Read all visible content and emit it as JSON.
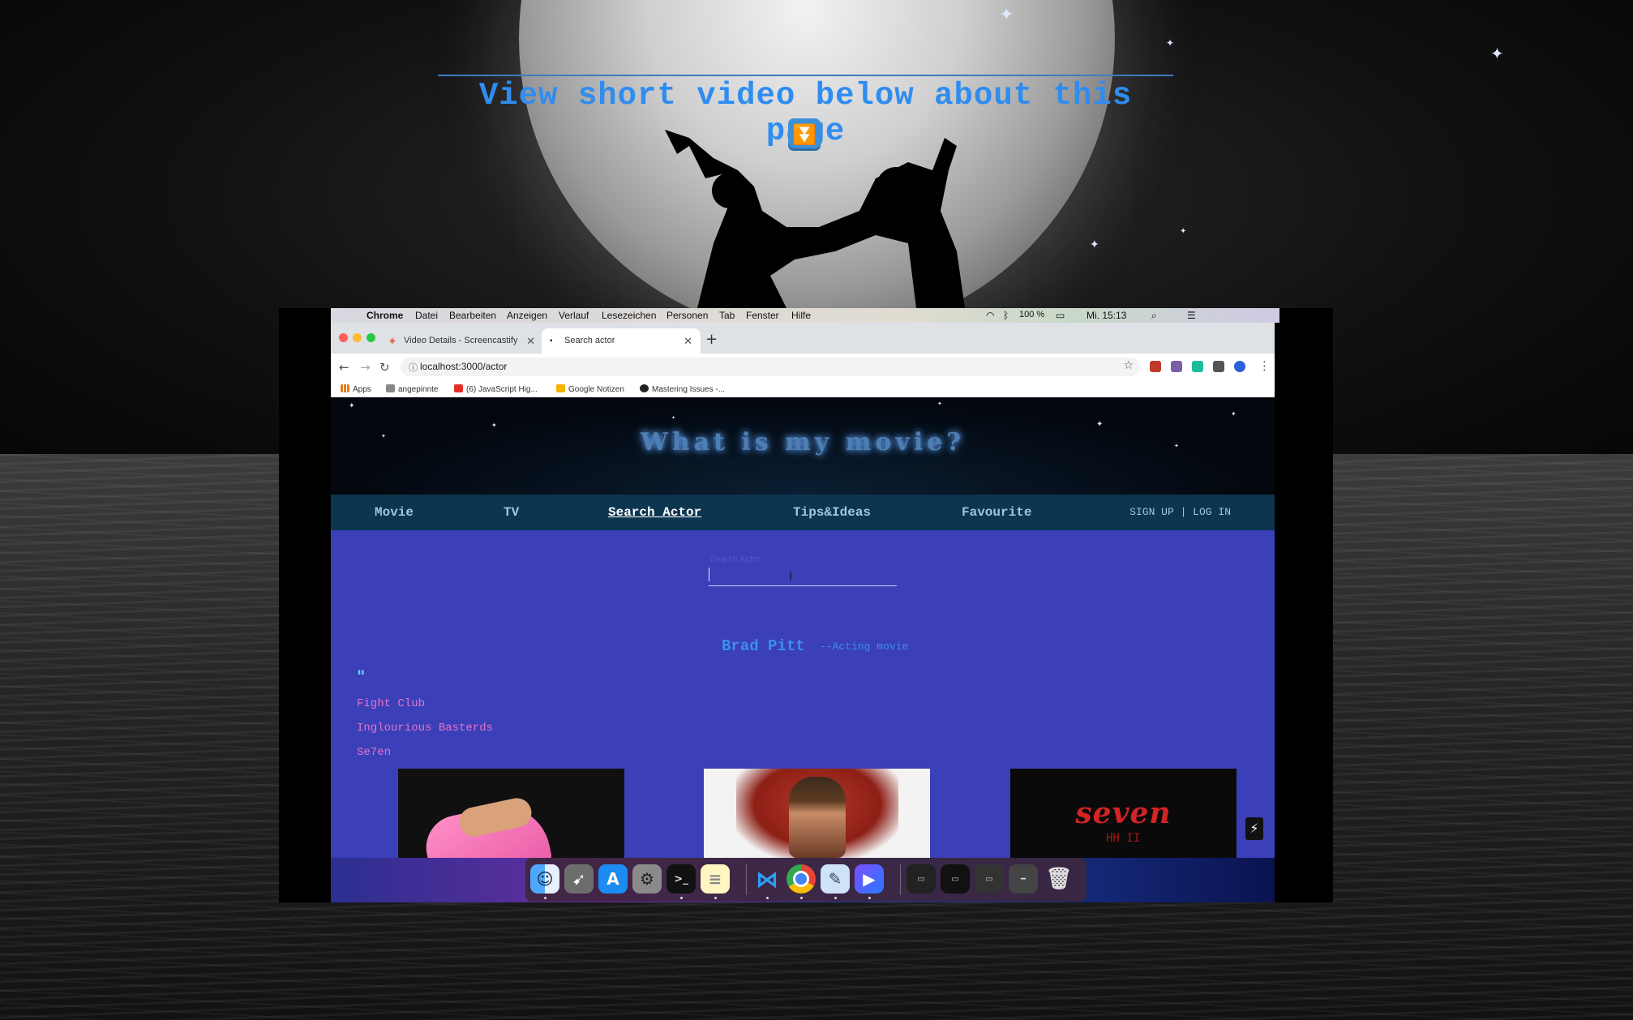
{
  "overlay": {
    "banner_text": "View short video below about this page",
    "banner_icon": "⏬"
  },
  "menubar": {
    "app": "Chrome",
    "items": [
      "Datei",
      "Bearbeiten",
      "Anzeigen",
      "Verlauf",
      "Lesezeichen",
      "Personen",
      "Tab",
      "Fenster",
      "Hilfe"
    ],
    "battery": "100 %",
    "clock": "Mi. 15:13"
  },
  "browser": {
    "tabs": [
      {
        "label": "Video Details - Screencastify",
        "active": false
      },
      {
        "label": "Search actor",
        "active": true
      }
    ],
    "url": "localhost:3000/actor",
    "bookmarks": [
      "Apps",
      "angepinnte",
      "(6) JavaScript Hig...",
      "Google Notizen",
      "Mastering Issues -..."
    ]
  },
  "site": {
    "title": "What is my movie?",
    "nav": [
      {
        "label": "Movie",
        "active": false
      },
      {
        "label": "TV",
        "active": false
      },
      {
        "label": "Search Actor",
        "active": true
      },
      {
        "label": "Tips&Ideas",
        "active": false
      },
      {
        "label": "Favourite",
        "active": false
      }
    ],
    "auth": "SIGN UP | LOG IN",
    "search_label": "Search Actor",
    "search_value": "",
    "actor_name": "Brad Pitt",
    "actor_suffix": "--Acting movie",
    "quote_mark": "\"",
    "movies": [
      "Fight Club",
      "Inglourious Basterds",
      "Se7en"
    ],
    "poster_text": "seven",
    "poster_marks": "HH II",
    "bolt": "⚡"
  },
  "dock": {
    "apps": [
      "Finder",
      "Launchpad",
      "App Store",
      "System Preferences",
      "Terminal",
      "Notes",
      "VS Code",
      "Chrome",
      "Preview",
      "Screencastify",
      "Chrome App",
      "Terminal Window",
      "Finder Window",
      "Chrome Window",
      "Trash"
    ]
  },
  "colors": {
    "accent_blue": "#2f8cf0",
    "content_bg": "#3b3fb8",
    "nav_bg": "#0c3550",
    "movie_link": "#e374c9"
  }
}
